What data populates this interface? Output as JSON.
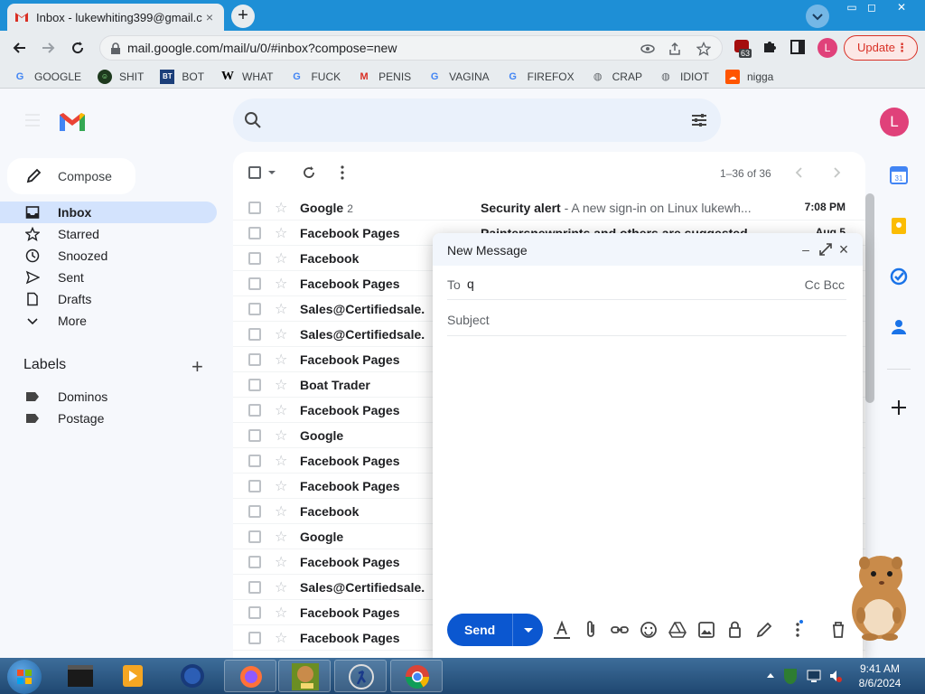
{
  "browser": {
    "tab_title": "Inbox - lukewhiting399@gmail.com",
    "tab_close": "×",
    "new_tab": "+",
    "url": "mail.google.com/mail/u/0/#inbox?compose=new",
    "profile_initial": "L",
    "update_label": "Update",
    "extension_badge": "63",
    "window_controls": [
      "▭",
      "◻",
      "✕"
    ]
  },
  "bookmarks": [
    {
      "label": "GOOGLE",
      "icon": "google-icon"
    },
    {
      "label": "SHIT",
      "icon": "dark-circle-icon"
    },
    {
      "label": "BOT",
      "icon": "bt-icon"
    },
    {
      "label": "WHAT",
      "icon": "w-icon"
    },
    {
      "label": "FUCK",
      "icon": "google-icon"
    },
    {
      "label": "PENIS",
      "icon": "gmail-icon"
    },
    {
      "label": "VAGINA",
      "icon": "google-icon"
    },
    {
      "label": "FIREFOX",
      "icon": "google-icon"
    },
    {
      "label": "CRAP",
      "icon": "globe-icon"
    },
    {
      "label": "IDIOT",
      "icon": "globe-icon"
    },
    {
      "label": "nigga",
      "icon": "soundcloud-icon"
    }
  ],
  "gmail": {
    "profile_initial": "L",
    "compose_label": "Compose",
    "nav": [
      {
        "label": "Inbox",
        "icon": "inbox-icon",
        "active": true
      },
      {
        "label": "Starred",
        "icon": "star-icon"
      },
      {
        "label": "Snoozed",
        "icon": "clock-icon"
      },
      {
        "label": "Sent",
        "icon": "send-icon"
      },
      {
        "label": "Drafts",
        "icon": "draft-icon"
      },
      {
        "label": "More",
        "icon": "chevron-down-icon"
      }
    ],
    "labels_heading": "Labels",
    "labels": [
      "Dominos",
      "Postage"
    ],
    "page_count": "1–36 of 36",
    "emails": [
      {
        "sender": "Google",
        "count": "2",
        "subject": "Security alert",
        "snippet": " - A new sign-in on Linux lukewh...",
        "time": "7:08 PM"
      },
      {
        "sender": "Facebook Pages",
        "subject": "Paintersnewprints and others are suggested...",
        "snippet": "",
        "time": "Aug 5"
      },
      {
        "sender": "Facebook",
        "subject": "",
        "snippet": "",
        "time": ""
      },
      {
        "sender": "Facebook Pages",
        "subject": "",
        "snippet": "",
        "time": ""
      },
      {
        "sender": "Sales@Certifiedsale.",
        "subject": "",
        "snippet": "",
        "time": ""
      },
      {
        "sender": "Sales@Certifiedsale.",
        "subject": "",
        "snippet": "",
        "time": ""
      },
      {
        "sender": "Facebook Pages",
        "subject": "",
        "snippet": "",
        "time": ""
      },
      {
        "sender": "Boat Trader",
        "subject": "",
        "snippet": "",
        "time": ""
      },
      {
        "sender": "Facebook Pages",
        "subject": "",
        "snippet": "",
        "time": ""
      },
      {
        "sender": "Google",
        "subject": "",
        "snippet": "",
        "time": ""
      },
      {
        "sender": "Facebook Pages",
        "subject": "",
        "snippet": "",
        "time": ""
      },
      {
        "sender": "Facebook Pages",
        "subject": "",
        "snippet": "",
        "time": ""
      },
      {
        "sender": "Facebook",
        "subject": "",
        "snippet": "",
        "time": ""
      },
      {
        "sender": "Google",
        "subject": "",
        "snippet": "",
        "time": ""
      },
      {
        "sender": "Facebook Pages",
        "subject": "",
        "snippet": "",
        "time": ""
      },
      {
        "sender": "Sales@Certifiedsale.",
        "subject": "",
        "snippet": "",
        "time": ""
      },
      {
        "sender": "Facebook Pages",
        "subject": "",
        "snippet": "",
        "time": ""
      },
      {
        "sender": "Facebook Pages",
        "subject": "",
        "snippet": "",
        "time": ""
      }
    ]
  },
  "compose": {
    "title": "New Message",
    "to_label": "To",
    "to_value": "q",
    "cc_bcc": "Cc Bcc",
    "subject_placeholder": "Subject",
    "subject_value": "",
    "send_label": "Send",
    "minimize": "–",
    "close": "×"
  },
  "taskbar": {
    "time": "9:41 AM",
    "date": "8/6/2024",
    "items": [
      "terminal-icon",
      "media-player-icon",
      "browser-globe-icon",
      "firefox-icon",
      "box-game-icon",
      "runner-app-icon",
      "chrome-icon"
    ]
  },
  "colors": {
    "accent": "#0b57d0",
    "tab_strip": "#1e8fd6",
    "avatar": "#e0417a",
    "inbox_active": "#d3e3fd"
  }
}
